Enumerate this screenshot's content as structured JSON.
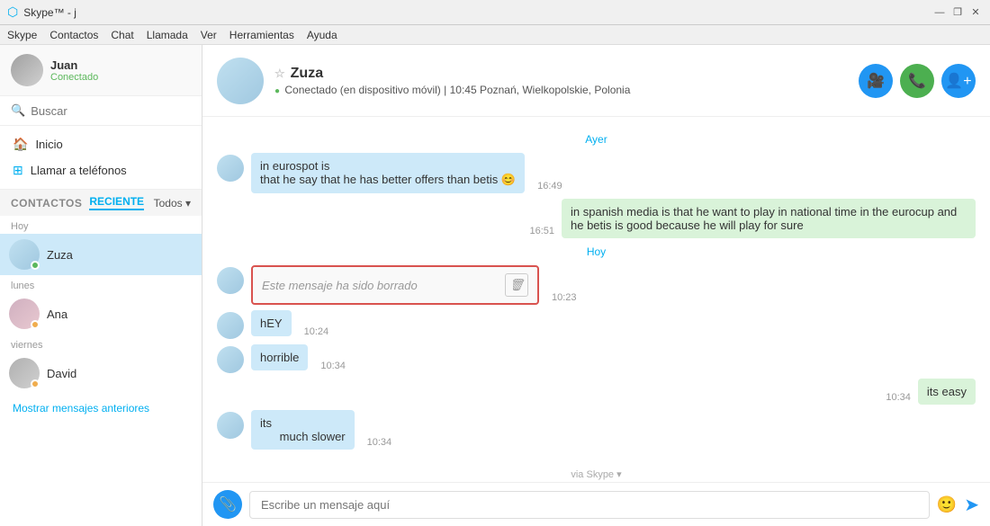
{
  "titlebar": {
    "title": "Skype™ - j",
    "min_btn": "—",
    "restore_btn": "❐",
    "close_btn": "✕"
  },
  "menubar": {
    "items": [
      "Skype",
      "Contactos",
      "Chat",
      "Llamada",
      "Ver",
      "Herramientas",
      "Ayuda"
    ]
  },
  "sidebar": {
    "profile": {
      "name": "Juan",
      "status": "Conectado"
    },
    "search_placeholder": "Buscar",
    "nav": [
      {
        "label": "Inicio",
        "icon": "🏠"
      },
      {
        "label": "Llamar a teléfonos",
        "icon": "⊞"
      }
    ],
    "contacts_label": "CONTACTOS",
    "recent_tab": "RECIENTE",
    "filter_label": "Todos",
    "groups": [
      {
        "label": "Hoy",
        "contacts": [
          {
            "name": "Zuza",
            "status": "online",
            "active": true
          }
        ]
      },
      {
        "label": "lunes",
        "contacts": [
          {
            "name": "Ana",
            "status": "away",
            "active": false
          }
        ]
      },
      {
        "label": "viernes",
        "contacts": [
          {
            "name": "David",
            "status": "away",
            "active": false
          }
        ]
      }
    ],
    "show_older": "Mostrar mensajes anteriores"
  },
  "chat": {
    "contact_name": "Zuza",
    "contact_status": "Conectado (en dispositivo móvil) | 10:45 Poznań, Wielkopolskie, Polonia",
    "day_separator_yesterday": "Ayer",
    "day_separator_today": "Hoy",
    "messages": [
      {
        "id": 1,
        "own": false,
        "text": "in eurospot is\nthat he say that he has better offers than betis 😊",
        "time": "16:49",
        "deleted": false
      },
      {
        "id": 2,
        "own": true,
        "text": "in spanish media is that he want to play in national time in the eurocup and he betis is good because he will play for sure",
        "time": "16:51",
        "deleted": false
      },
      {
        "id": 3,
        "own": false,
        "text": "Este mensaje ha sido borrado",
        "time": "10:23",
        "deleted": true
      },
      {
        "id": 4,
        "own": false,
        "text": "hEY",
        "time": "10:24",
        "deleted": false
      },
      {
        "id": 5,
        "own": false,
        "text": "horrible",
        "time": "10:34",
        "deleted": false
      },
      {
        "id": 6,
        "own": true,
        "text": "its easy",
        "time": "10:34",
        "deleted": false
      },
      {
        "id": 7,
        "own": false,
        "text": "its\nmuch slower",
        "time": "10:34",
        "deleted": false
      }
    ],
    "via_skype": "via Skype ▾",
    "input_placeholder": "Escribe un mensaje aquí"
  }
}
